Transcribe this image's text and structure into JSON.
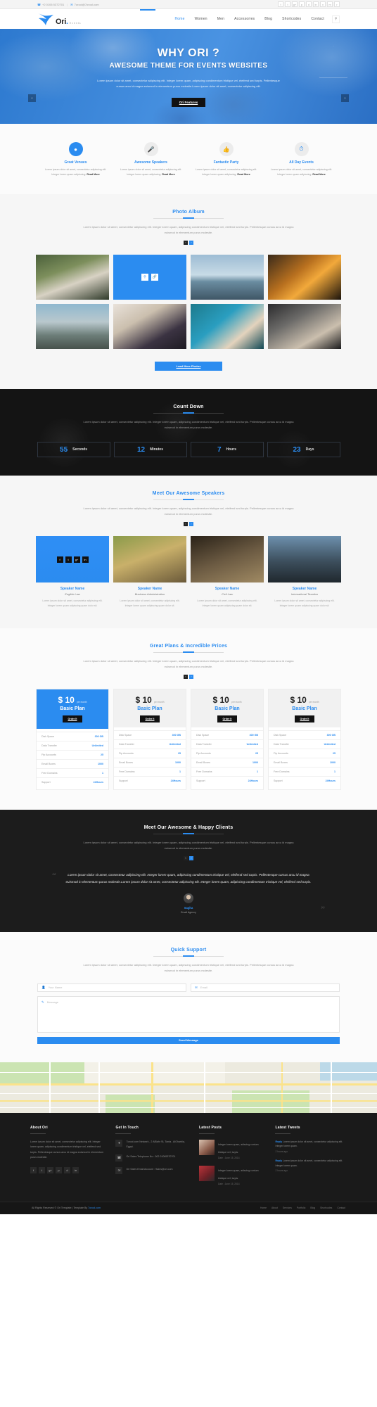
{
  "topbar": {
    "phone": "+2 0106 5372701",
    "email": "7orool@7orool.com",
    "socials": [
      "f",
      "t",
      "g+",
      "p",
      "d",
      "in",
      "v",
      "m",
      "r"
    ]
  },
  "header": {
    "logo": "Ori",
    "logo_sub": "Events",
    "nav": [
      {
        "label": "Home",
        "active": true
      },
      {
        "label": "Women",
        "active": false
      },
      {
        "label": "Men",
        "active": false
      },
      {
        "label": "Accessories",
        "active": false
      },
      {
        "label": "Blog",
        "active": false
      },
      {
        "label": "Shortcodes",
        "active": false
      },
      {
        "label": "Contact",
        "active": false
      }
    ],
    "search_icon": "search-icon"
  },
  "hero": {
    "title": "WHY ORI ?",
    "subtitle": "AWESOME THEME FOR EVENTS WEBSITES",
    "paragraph": "Lorem ipsum dolor sit amet, consectetur adipiscing elit. Integer lorem quam, adipiscing condimentum tristique vel, eleifend sed turpis. Pellentesque cursus arcu id magna euismod in elementum purus molestie.Lorem ipsum dolor sit amet, consectetur adipiscing elit.",
    "button": "Ori Features",
    "prev": "‹",
    "next": "›"
  },
  "features": [
    {
      "icon": "map-marker-icon",
      "title": "Great Venues",
      "text": "Lorem ipsum dolor sit amet, consectetur adipiscing elit. Integer lorem quam adipiscing.",
      "more": "Read More",
      "active": true
    },
    {
      "icon": "microphone-icon",
      "title": "Awesome Speakers",
      "text": "Lorem ipsum dolor sit amet, consectetur adipiscing elit. Integer lorem quam adipiscing.",
      "more": "Read More",
      "active": false
    },
    {
      "icon": "thumbs-up-icon",
      "title": "Fantastic Party",
      "text": "Lorem ipsum dolor sit amet, consectetur adipiscing elit. Integer lorem quam adipiscing.",
      "more": "Read More",
      "active": false
    },
    {
      "icon": "clock-icon",
      "title": "All Day Events",
      "text": "Lorem ipsum dolor sit amet, consectetur adipiscing elit. Integer lorem quam adipiscing.",
      "more": "Read More",
      "active": false
    }
  ],
  "album": {
    "title": "Photo Album",
    "text": "Lorem ipsum dolor sit amet, consectetur adipiscing elit. Integer lorem quam, adipiscing condimentum tristique vel, eleifend sed turpis. Pellentesque cursus arcu id magna euismod in elementum purus molestie.",
    "prev": "‹",
    "next": "›",
    "overlay_icons": [
      "zoom-icon",
      "link-icon"
    ],
    "load_more": "Load More Photos"
  },
  "countdown": {
    "title": "Count Down",
    "text": "Lorem ipsum dolor sit amet, consectetur adipiscing elit. Integer lorem quam, adipiscing condimentum tristique vel, eleifend sed turpis. Pellentesque cursus arcu id magna euismod in elementum purus molestie.",
    "items": [
      {
        "value": "55",
        "label": "Seconds"
      },
      {
        "value": "12",
        "label": "Minutes"
      },
      {
        "value": "7",
        "label": "Hours"
      },
      {
        "value": "23",
        "label": "Days"
      }
    ]
  },
  "speakers": {
    "title": "Meet Our Awesome Speakers",
    "text": "Lorem ipsum dolor sit amet, consectetur adipiscing elit. Integer lorem quam, adipiscing condimentum tristique vel, eleifend sed turpis. Pellentesque cursus arcu id magna euismod in elementum purus molestie.",
    "prev": "‹",
    "next": "›",
    "social_icons": [
      "f",
      "t",
      "g+",
      "in"
    ],
    "list": [
      {
        "name": "Speaker Name",
        "role": "English Law",
        "text": "Lorem ipsum dolor sit amet, consectetur adipiscing elit. Integer lorem quam adipiscing quam dolor sit."
      },
      {
        "name": "Speaker Name",
        "role": "Business Administration",
        "text": "Lorem ipsum dolor sit amet, consectetur adipiscing elit. Integer lorem quam adipiscing quam dolor sit."
      },
      {
        "name": "Speaker Name",
        "role": "Civil Law",
        "text": "Lorem ipsum dolor sit amet, consectetur adipiscing elit. Integer lorem quam adipiscing quam dolor sit."
      },
      {
        "name": "Speaker Name",
        "role": "International Taxation",
        "text": "Lorem ipsum dolor sit amet, consectetur adipiscing elit. Integer lorem quam adipiscing quam dolor sit."
      }
    ]
  },
  "pricing": {
    "title": "Great Plans & Incredible Prices",
    "text": "Lorem ipsum dolor sit amet, consectetur adipiscing elit. Integer lorem quam, adipiscing condimentum tristique vel, eleifend sed turpis. Pellentesque cursus arcu id magna euismod in elementum purus molestie.",
    "prev": "‹",
    "next": "›",
    "feature_labels": [
      "Disk Space",
      "Data Transfer",
      "Ftp Accounts",
      "Email Boxes",
      "Free Domains",
      "Support"
    ],
    "plans": [
      {
        "price": "$ 10",
        "per": "per month",
        "name": "Basic Plan",
        "button": "Order It",
        "featured": true,
        "values": [
          "300 GB",
          "Unlimited",
          "25",
          "1000",
          "1",
          "24Hours"
        ]
      },
      {
        "price": "$ 10",
        "per": "per month",
        "name": "Basic Plan",
        "button": "Order It",
        "featured": false,
        "values": [
          "300 GB",
          "Unlimited",
          "25",
          "1000",
          "1",
          "24Hours"
        ]
      },
      {
        "price": "$ 10",
        "per": "per month",
        "name": "Basic Plan",
        "button": "Order It",
        "featured": false,
        "values": [
          "300 GB",
          "Unlimited",
          "25",
          "1000",
          "1",
          "24Hours"
        ]
      },
      {
        "price": "$ 10",
        "per": "per month",
        "name": "Basic Plan",
        "button": "Order It",
        "featured": false,
        "values": [
          "300 GB",
          "Unlimited",
          "25",
          "1000",
          "1",
          "24Hours"
        ]
      }
    ]
  },
  "clients": {
    "title": "Meet Our Awesome & Happy Clients",
    "text": "Lorem ipsum dolor sit amet, consectetur adipiscing elit. Integer lorem quam, adipiscing condimentum tristique vel, eleifend sed turpis. Pellentesque cursus arcu id magna euismod in elementum purus molestie.",
    "prev": "‹",
    "next": "›",
    "quote": "Lorem ipsum dolor sit amet, consectetur adipiscing elit. Integer lorem quam, adipiscing condimentum tristique vel, eleifend sed turpis. Pellentesque cursus arcu id magna euismod in elementum purus molestie.Lorem ipsum dolor sit amet, consectetur adipiscing elit. Integer lorem quam, adipiscing condimentum tristique vel, eleifend sed turpis.",
    "author": "Sagha",
    "author_role": "Email Agency"
  },
  "support": {
    "title": "Quick Support",
    "text": "Lorem ipsum dolor sit amet, consectetur adipiscing elit. Integer lorem quam, adipiscing condimentum tristique vel, eleifend sed turpis. Pellentesque cursus arcu id magna euismod in elementum purus molestie.",
    "name_placeholder": "Your Name",
    "email_placeholder": "Email",
    "message_placeholder": "Message",
    "name_icon": "user-icon",
    "email_icon": "envelope-icon",
    "message_icon": "pencil-icon",
    "send": "Send Message"
  },
  "footer": {
    "about": {
      "title": "About Ori",
      "text": "Lorem ipsum dolor sit amet, consectetur adipiscing elit. Integer lorem quam, adipiscing condimentum tristique vel, eleifend sed turpis. Pellentesque cursus arcu id magna euismod in elementum purus molestie.",
      "socials": [
        "f",
        "t",
        "g+",
        "p",
        "d",
        "in"
      ]
    },
    "touch": {
      "title": "Get In Touch",
      "items": [
        {
          "icon": "map-marker-icon",
          "text": "7orool.com Network , 2 AlBahr St, Tanta , AlGharbia, Egypt."
        },
        {
          "icon": "phone-icon",
          "text": "Ori Sales Telephone No : 002 01065370701"
        },
        {
          "icon": "envelope-icon",
          "text": "Ori Sales Email Account : Sales@ori.com"
        }
      ]
    },
    "posts": {
      "title": "Latest Posts",
      "items": [
        {
          "text": "Integer lorem quam, adiscing contum tristique vel, turpis.",
          "date": "Date : June 15, 2014"
        },
        {
          "text": "Integer lorem quam, adiscing contum tristique vel, turpis.",
          "date": "Date : June 15, 2014"
        }
      ]
    },
    "tweets": {
      "title": "Latest Tweets",
      "items": [
        {
          "reply": "Reply",
          "text": "Lorem ipsum dolor sit amet, consectetur adipiscing elit. Integer lorem quam.",
          "ago": "2 hours ago"
        },
        {
          "reply": "Reply",
          "text": "Lorem ipsum dolor sit amet, consectetur adipiscing elit. Integer lorem quam.",
          "ago": "2 hours ago"
        }
      ]
    },
    "copyright_prefix": "All Rights Reserved © Ori Template   |   Template By ",
    "copyright_link": "7orool.com",
    "menu": [
      "Home",
      "About",
      "Services",
      "Portfolio",
      "Blog",
      "Shortcodes",
      "Contact"
    ]
  }
}
